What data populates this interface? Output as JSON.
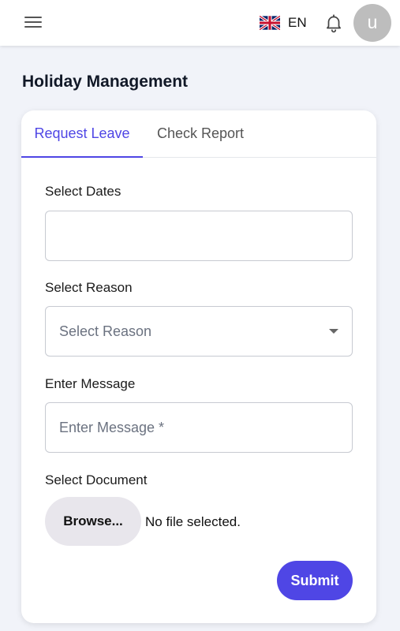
{
  "header": {
    "language": {
      "flag": "uk-flag-icon",
      "code": "EN"
    },
    "notifications_icon": "bell-icon",
    "menu_icon": "hamburger-menu-icon",
    "avatar_initial": "u"
  },
  "page": {
    "title": "Holiday Management"
  },
  "tabs": [
    {
      "label": "Request Leave",
      "active": true
    },
    {
      "label": "Check Report",
      "active": false
    }
  ],
  "form": {
    "dates": {
      "label": "Select Dates",
      "value": ""
    },
    "reason": {
      "label": "Select Reason",
      "placeholder": "Select Reason"
    },
    "message": {
      "label": "Enter Message",
      "placeholder": "Enter Message *"
    },
    "document": {
      "label": "Select Document",
      "browse_label": "Browse...",
      "status": "No file selected."
    },
    "submit_label": "Submit"
  },
  "colors": {
    "accent": "#4f46e5",
    "background": "#f1f3f9",
    "avatar": "#bdbdbd"
  }
}
